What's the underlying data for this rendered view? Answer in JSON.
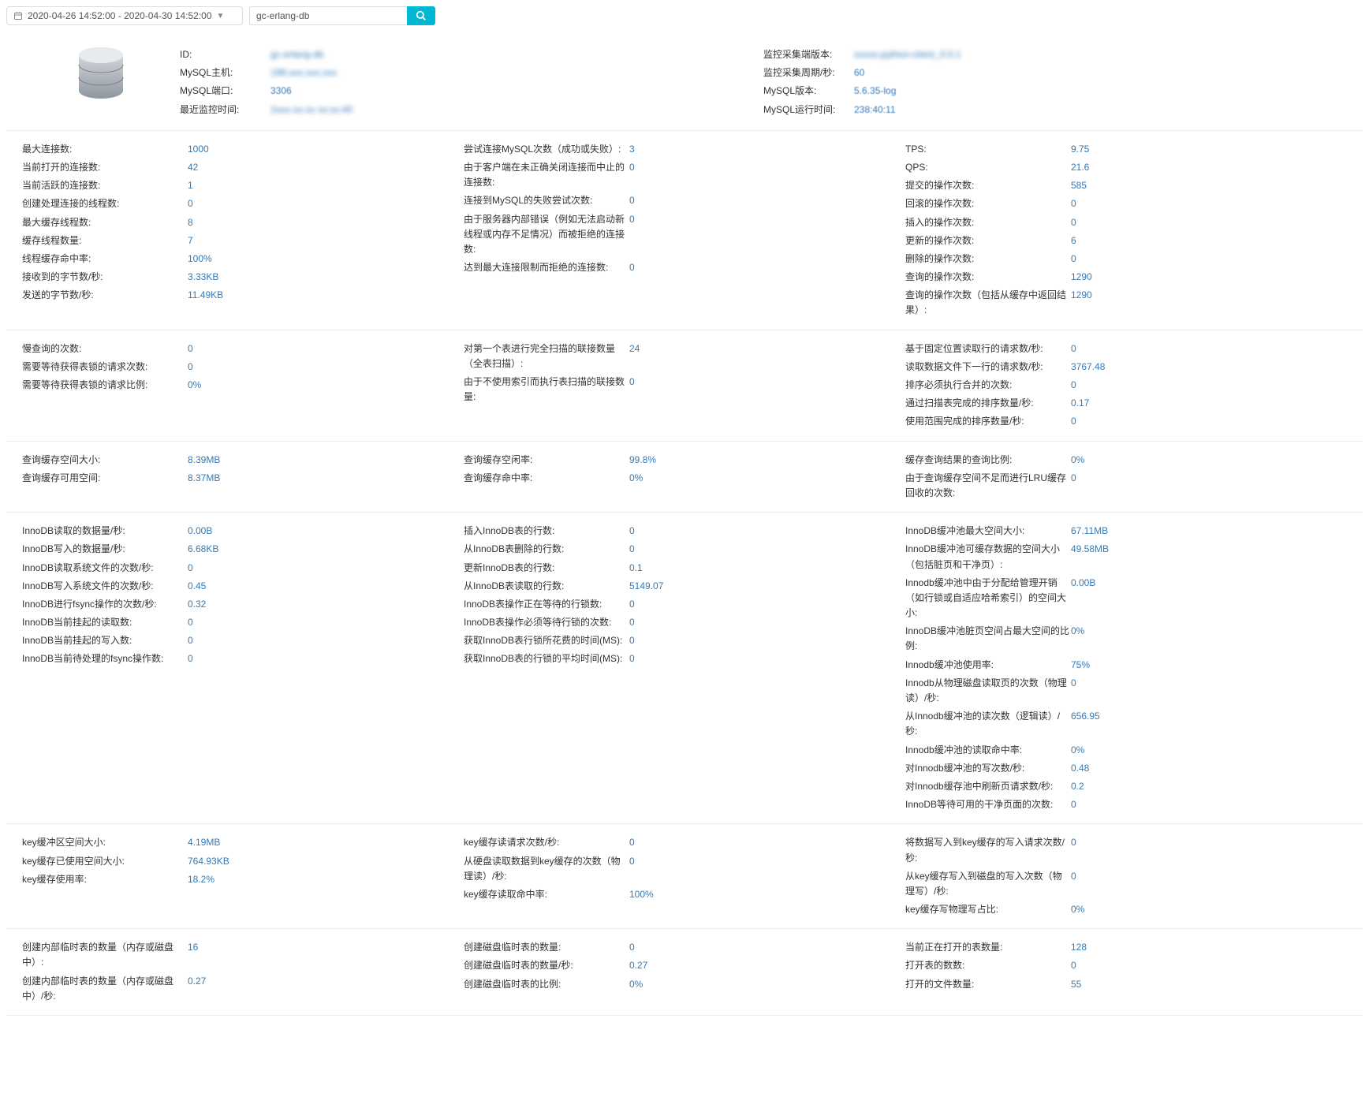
{
  "topbar": {
    "dateRange": "2020-04-26 14:52:00 - 2020-04-30 14:52:00",
    "searchValue": "gc-erlang-db"
  },
  "header": {
    "left": [
      {
        "label": "ID:",
        "value": "gc-erlang-db",
        "blur": true
      },
      {
        "label": "MySQL主机:",
        "value": "198.xxx.xxx.xxx",
        "blur": true
      },
      {
        "label": "MySQL端口:",
        "value": "3306"
      },
      {
        "label": "最近监控时间:",
        "value": "2xxx-xx-xx xx:xx:40",
        "blur": true
      }
    ],
    "right": [
      {
        "label": "监控采集端版本:",
        "value": "xxxxx-python-client_0.0.1",
        "blur": true
      },
      {
        "label": "监控采集周期/秒:",
        "value": "60"
      },
      {
        "label": "MySQL版本:",
        "value": "5.6.35-log"
      },
      {
        "label": "MySQL运行时间:",
        "value": "238:40:11"
      }
    ]
  },
  "sections": [
    {
      "cols": [
        [
          {
            "k": "最大连接数:",
            "v": "1000"
          },
          {
            "k": "当前打开的连接数:",
            "v": "42"
          },
          {
            "k": "当前活跃的连接数:",
            "v": "1"
          },
          {
            "k": "创建处理连接的线程数:",
            "v": "0"
          },
          {
            "k": "最大缓存线程数:",
            "v": "8"
          },
          {
            "k": "缓存线程数量:",
            "v": "7"
          },
          {
            "k": "线程缓存命中率:",
            "v": "100%"
          },
          {
            "k": "接收到的字节数/秒:",
            "v": "3.33KB"
          },
          {
            "k": "发送的字节数/秒:",
            "v": "11.49KB"
          }
        ],
        [
          {
            "k": "尝试连接MySQL次数（成功或失败）:",
            "v": "3"
          },
          {
            "k": "由于客户端在未正确关闭连接而中止的连接数:",
            "v": "0"
          },
          {
            "k": "连接到MySQL的失败尝试次数:",
            "v": "0"
          },
          {
            "k": "由于服务器内部错误（例如无法启动新线程或内存不足情况）而被拒绝的连接数:",
            "v": "0"
          },
          {
            "k": "达到最大连接限制而拒绝的连接数:",
            "v": "0"
          }
        ],
        [
          {
            "k": "TPS:",
            "v": "9.75"
          },
          {
            "k": "QPS:",
            "v": "21.6"
          },
          {
            "k": "提交的操作次数:",
            "v": "585"
          },
          {
            "k": "回滚的操作次数:",
            "v": "0"
          },
          {
            "k": "插入的操作次数:",
            "v": "0"
          },
          {
            "k": "更新的操作次数:",
            "v": "6"
          },
          {
            "k": "删除的操作次数:",
            "v": "0"
          },
          {
            "k": "查询的操作次数:",
            "v": "1290"
          },
          {
            "k": "查询的操作次数（包括从缓存中返回结果）:",
            "v": "1290"
          }
        ]
      ]
    },
    {
      "cols": [
        [
          {
            "k": "慢查询的次数:",
            "v": "0"
          },
          {
            "k": "需要等待获得表锁的请求次数:",
            "v": "0"
          },
          {
            "k": "需要等待获得表锁的请求比例:",
            "v": "0%"
          }
        ],
        [
          {
            "k": "对第一个表进行完全扫描的联接数量（全表扫描）:",
            "v": "24"
          },
          {
            "k": "由于不使用索引而执行表扫描的联接数量:",
            "v": "0"
          }
        ],
        [
          {
            "k": "基于固定位置读取行的请求数/秒:",
            "v": "0"
          },
          {
            "k": "读取数据文件下一行的请求数/秒:",
            "v": "3767.48"
          },
          {
            "k": "排序必须执行合并的次数:",
            "v": "0"
          },
          {
            "k": "通过扫描表完成的排序数量/秒:",
            "v": "0.17"
          },
          {
            "k": "使用范围完成的排序数量/秒:",
            "v": "0"
          }
        ]
      ]
    },
    {
      "cols": [
        [
          {
            "k": "查询缓存空间大小:",
            "v": "8.39MB"
          },
          {
            "k": "查询缓存可用空间:",
            "v": "8.37MB"
          }
        ],
        [
          {
            "k": "查询缓存空闲率:",
            "v": "99.8%"
          },
          {
            "k": "查询缓存命中率:",
            "v": "0%"
          }
        ],
        [
          {
            "k": "缓存查询结果的查询比例:",
            "v": "0%"
          },
          {
            "k": "由于查询缓存空间不足而进行LRU缓存回收的次数:",
            "v": "0"
          }
        ]
      ]
    },
    {
      "cols": [
        [
          {
            "k": "InnoDB读取的数据量/秒:",
            "v": "0.00B"
          },
          {
            "k": "InnoDB写入的数据量/秒:",
            "v": "6.68KB"
          },
          {
            "k": "InnoDB读取系统文件的次数/秒:",
            "v": "0"
          },
          {
            "k": "InnoDB写入系统文件的次数/秒:",
            "v": "0.45"
          },
          {
            "k": "InnoDB进行fsync操作的次数/秒:",
            "v": "0.32"
          },
          {
            "k": "InnoDB当前挂起的读取数:",
            "v": "0"
          },
          {
            "k": "InnoDB当前挂起的写入数:",
            "v": "0"
          },
          {
            "k": "InnoDB当前待处理的fsync操作数:",
            "v": "0"
          }
        ],
        [
          {
            "k": "插入InnoDB表的行数:",
            "v": "0"
          },
          {
            "k": "从InnoDB表删除的行数:",
            "v": "0"
          },
          {
            "k": "更新InnoDB表的行数:",
            "v": "0.1"
          },
          {
            "k": "从InnoDB表读取的行数:",
            "v": "5149.07"
          },
          {
            "k": "InnoDB表操作正在等待的行锁数:",
            "v": "0"
          },
          {
            "k": "InnoDB表操作必须等待行锁的次数:",
            "v": "0"
          },
          {
            "k": "获取InnoDB表行锁所花费的时间(MS):",
            "v": "0"
          },
          {
            "k": "获取InnoDB表的行锁的平均时间(MS):",
            "v": "0"
          }
        ],
        [
          {
            "k": "InnoDB缓冲池最大空间大小:",
            "v": "67.11MB"
          },
          {
            "k": "InnoDB缓冲池可缓存数据的空间大小（包括脏页和干净页）:",
            "v": "49.58MB"
          },
          {
            "k": "Innodb缓冲池中由于分配给管理开销（如行锁或自适应哈希索引）的空间大小:",
            "v": "0.00B"
          },
          {
            "k": "InnoDB缓冲池脏页空间占最大空间的比例:",
            "v": "0%"
          },
          {
            "k": "Innodb缓冲池使用率:",
            "v": "75%"
          },
          {
            "k": "Innodb从物理磁盘读取页的次数（物理读）/秒:",
            "v": "0"
          },
          {
            "k": "从Innodb缓冲池的读次数（逻辑读）/秒:",
            "v": "656.95"
          },
          {
            "k": "Innodb缓冲池的读取命中率:",
            "v": "0%"
          },
          {
            "k": "对Innodb缓冲池的写次数/秒:",
            "v": "0.48"
          },
          {
            "k": "对Innodb缓存池中刷新页请求数/秒:",
            "v": "0.2"
          },
          {
            "k": "InnoDB等待可用的干净页面的次数:",
            "v": "0"
          }
        ]
      ]
    },
    {
      "cols": [
        [
          {
            "k": "key缓冲区空间大小:",
            "v": "4.19MB"
          },
          {
            "k": "key缓存已使用空间大小:",
            "v": "764.93KB"
          },
          {
            "k": "key缓存使用率:",
            "v": "18.2%"
          }
        ],
        [
          {
            "k": "key缓存读请求次数/秒:",
            "v": "0"
          },
          {
            "k": "从硬盘读取数据到key缓存的次数（物理读）/秒:",
            "v": "0"
          },
          {
            "k": "key缓存读取命中率:",
            "v": "100%"
          }
        ],
        [
          {
            "k": "将数据写入到key缓存的写入请求次数/秒:",
            "v": "0"
          },
          {
            "k": "从key缓存写入到磁盘的写入次数（物理写）/秒:",
            "v": "0"
          },
          {
            "k": "key缓存写物理写占比:",
            "v": "0%"
          }
        ]
      ]
    },
    {
      "cols": [
        [
          {
            "k": "创建内部临时表的数量（内存或磁盘中）:",
            "v": "16"
          },
          {
            "k": "创建内部临时表的数量（内存或磁盘中）/秒:",
            "v": "0.27"
          }
        ],
        [
          {
            "k": "创建磁盘临时表的数量:",
            "v": "0"
          },
          {
            "k": "创建磁盘临时表的数量/秒:",
            "v": "0.27"
          },
          {
            "k": "创建磁盘临时表的比例:",
            "v": "0%"
          }
        ],
        [
          {
            "k": "当前正在打开的表数量:",
            "v": "128"
          },
          {
            "k": "打开表的数数:",
            "v": "0"
          },
          {
            "k": "打开的文件数量:",
            "v": "55"
          }
        ]
      ]
    }
  ]
}
